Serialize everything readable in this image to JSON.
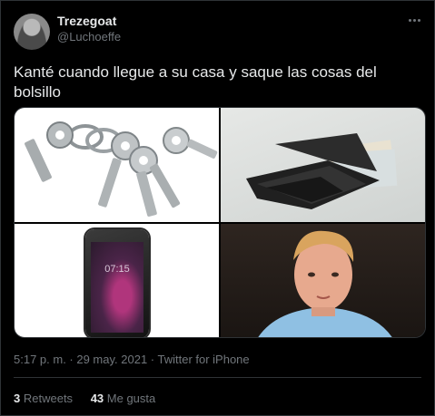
{
  "tweet": {
    "display_name": "Trezegoat",
    "handle": "@Luchoeffe",
    "text": "Kanté cuando llegue a su casa y saque las cosas del bolsillo",
    "timestamp": "5:17 p. m. · 29 may. 2021 · Twitter for iPhone",
    "retweets_count": "3",
    "retweets_label": "Retweets",
    "likes_count": "43",
    "likes_label": "Me gusta",
    "phone_clock": "07:15",
    "icons": {
      "more": "more-options-icon"
    },
    "media": [
      "keys-photo",
      "wallet-photo",
      "phone-photo",
      "player-photo"
    ]
  }
}
